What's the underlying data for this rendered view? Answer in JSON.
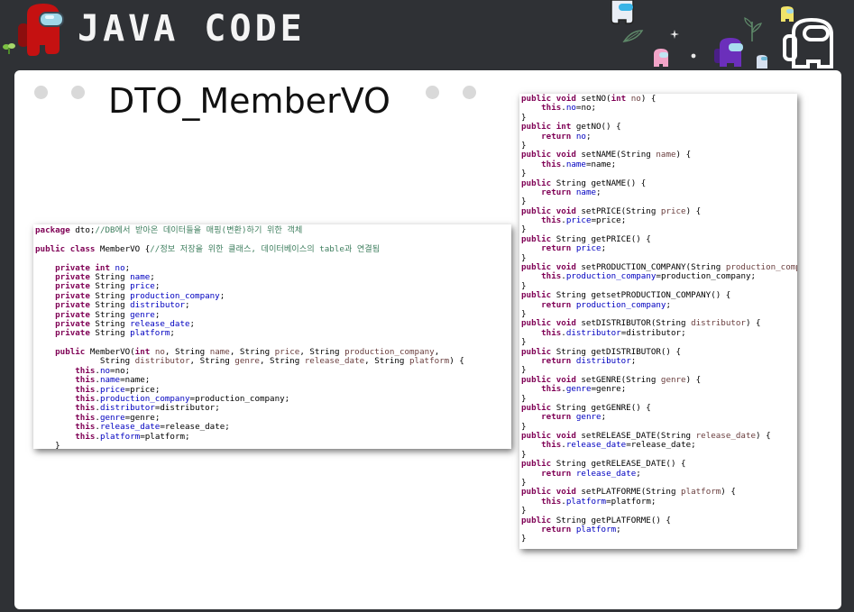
{
  "header": {
    "title": "JAVA CODE"
  },
  "slide": {
    "title": "DTO_MemberVO"
  },
  "left_code": [
    [
      [
        "kw",
        "package"
      ],
      [
        "plain",
        " dto;"
      ],
      [
        "comment",
        "//DB에서 받아온 데이터들을 매핑(변환)하기 위한 객체"
      ]
    ],
    [],
    [
      [
        "kw",
        "public class"
      ],
      [
        "plain",
        " MemberVO {"
      ],
      [
        "comment",
        "//정보 저장을 위한 클래스, 데이터베이스의 table과 연결됨"
      ]
    ],
    [],
    [
      [
        "plain",
        "    "
      ],
      [
        "kw",
        "private int"
      ],
      [
        "plain",
        " "
      ],
      [
        "field",
        "no"
      ],
      [
        "plain",
        ";"
      ]
    ],
    [
      [
        "plain",
        "    "
      ],
      [
        "kw",
        "private"
      ],
      [
        "plain",
        " String "
      ],
      [
        "field",
        "name"
      ],
      [
        "plain",
        ";"
      ]
    ],
    [
      [
        "plain",
        "    "
      ],
      [
        "kw",
        "private"
      ],
      [
        "plain",
        " String "
      ],
      [
        "field",
        "price"
      ],
      [
        "plain",
        ";"
      ]
    ],
    [
      [
        "plain",
        "    "
      ],
      [
        "kw",
        "private"
      ],
      [
        "plain",
        " String "
      ],
      [
        "field",
        "production_company"
      ],
      [
        "plain",
        ";"
      ]
    ],
    [
      [
        "plain",
        "    "
      ],
      [
        "kw",
        "private"
      ],
      [
        "plain",
        " String "
      ],
      [
        "field",
        "distributor"
      ],
      [
        "plain",
        ";"
      ]
    ],
    [
      [
        "plain",
        "    "
      ],
      [
        "kw",
        "private"
      ],
      [
        "plain",
        " String "
      ],
      [
        "field",
        "genre"
      ],
      [
        "plain",
        ";"
      ]
    ],
    [
      [
        "plain",
        "    "
      ],
      [
        "kw",
        "private"
      ],
      [
        "plain",
        " String "
      ],
      [
        "field",
        "release_date"
      ],
      [
        "plain",
        ";"
      ]
    ],
    [
      [
        "plain",
        "    "
      ],
      [
        "kw",
        "private"
      ],
      [
        "plain",
        " String "
      ],
      [
        "field",
        "platform"
      ],
      [
        "plain",
        ";"
      ]
    ],
    [],
    [
      [
        "plain",
        "    "
      ],
      [
        "kw",
        "public"
      ],
      [
        "plain",
        " MemberVO("
      ],
      [
        "kw",
        "int"
      ],
      [
        "plain",
        " "
      ],
      [
        "param",
        "no"
      ],
      [
        "plain",
        ", String "
      ],
      [
        "param",
        "name"
      ],
      [
        "plain",
        ", String "
      ],
      [
        "param",
        "price"
      ],
      [
        "plain",
        ", String "
      ],
      [
        "param",
        "production_company"
      ],
      [
        "plain",
        ","
      ]
    ],
    [
      [
        "plain",
        "             String "
      ],
      [
        "param",
        "distributor"
      ],
      [
        "plain",
        ", String "
      ],
      [
        "param",
        "genre"
      ],
      [
        "plain",
        ", String "
      ],
      [
        "param",
        "release_date"
      ],
      [
        "plain",
        ", String "
      ],
      [
        "param",
        "platform"
      ],
      [
        "plain",
        ") {"
      ]
    ],
    [
      [
        "plain",
        "        "
      ],
      [
        "kw",
        "this"
      ],
      [
        "plain",
        "."
      ],
      [
        "field",
        "no"
      ],
      [
        "plain",
        "=no;"
      ]
    ],
    [
      [
        "plain",
        "        "
      ],
      [
        "kw",
        "this"
      ],
      [
        "plain",
        "."
      ],
      [
        "field",
        "name"
      ],
      [
        "plain",
        "=name;"
      ]
    ],
    [
      [
        "plain",
        "        "
      ],
      [
        "kw",
        "this"
      ],
      [
        "plain",
        "."
      ],
      [
        "field",
        "price"
      ],
      [
        "plain",
        "=price;"
      ]
    ],
    [
      [
        "plain",
        "        "
      ],
      [
        "kw",
        "this"
      ],
      [
        "plain",
        "."
      ],
      [
        "field",
        "production_company"
      ],
      [
        "plain",
        "=production_company;"
      ]
    ],
    [
      [
        "plain",
        "        "
      ],
      [
        "kw",
        "this"
      ],
      [
        "plain",
        "."
      ],
      [
        "field",
        "distributor"
      ],
      [
        "plain",
        "=distributor;"
      ]
    ],
    [
      [
        "plain",
        "        "
      ],
      [
        "kw",
        "this"
      ],
      [
        "plain",
        "."
      ],
      [
        "field",
        "genre"
      ],
      [
        "plain",
        "=genre;"
      ]
    ],
    [
      [
        "plain",
        "        "
      ],
      [
        "kw",
        "this"
      ],
      [
        "plain",
        "."
      ],
      [
        "field",
        "release_date"
      ],
      [
        "plain",
        "=release_date;"
      ]
    ],
    [
      [
        "plain",
        "        "
      ],
      [
        "kw",
        "this"
      ],
      [
        "plain",
        "."
      ],
      [
        "field",
        "platform"
      ],
      [
        "plain",
        "=platform;"
      ]
    ],
    [
      [
        "plain",
        "    }"
      ]
    ]
  ],
  "right_code": [
    [
      [
        "kw",
        "public void"
      ],
      [
        "plain",
        " setNO("
      ],
      [
        "kw",
        "int"
      ],
      [
        "plain",
        " "
      ],
      [
        "param",
        "no"
      ],
      [
        "plain",
        ") {"
      ]
    ],
    [
      [
        "plain",
        "    "
      ],
      [
        "kw",
        "this"
      ],
      [
        "plain",
        "."
      ],
      [
        "field",
        "no"
      ],
      [
        "plain",
        "=no;"
      ]
    ],
    [
      [
        "plain",
        "}"
      ]
    ],
    [
      [
        "kw",
        "public int"
      ],
      [
        "plain",
        " getNO() {"
      ]
    ],
    [
      [
        "plain",
        "    "
      ],
      [
        "kw",
        "return"
      ],
      [
        "plain",
        " "
      ],
      [
        "field",
        "no"
      ],
      [
        "plain",
        ";"
      ]
    ],
    [
      [
        "plain",
        "}"
      ]
    ],
    [
      [
        "kw",
        "public void"
      ],
      [
        "plain",
        " setNAME(String "
      ],
      [
        "param",
        "name"
      ],
      [
        "plain",
        ") {"
      ]
    ],
    [
      [
        "plain",
        "    "
      ],
      [
        "kw",
        "this"
      ],
      [
        "plain",
        "."
      ],
      [
        "field",
        "name"
      ],
      [
        "plain",
        "=name;"
      ]
    ],
    [
      [
        "plain",
        "}"
      ]
    ],
    [
      [
        "kw",
        "public"
      ],
      [
        "plain",
        " String getNAME() {"
      ]
    ],
    [
      [
        "plain",
        "    "
      ],
      [
        "kw",
        "return"
      ],
      [
        "plain",
        " "
      ],
      [
        "field",
        "name"
      ],
      [
        "plain",
        ";"
      ]
    ],
    [
      [
        "plain",
        "}"
      ]
    ],
    [
      [
        "kw",
        "public void"
      ],
      [
        "plain",
        " setPRICE(String "
      ],
      [
        "param",
        "price"
      ],
      [
        "plain",
        ") {"
      ]
    ],
    [
      [
        "plain",
        "    "
      ],
      [
        "kw",
        "this"
      ],
      [
        "plain",
        "."
      ],
      [
        "field",
        "price"
      ],
      [
        "plain",
        "=price;"
      ]
    ],
    [
      [
        "plain",
        "}"
      ]
    ],
    [
      [
        "kw",
        "public"
      ],
      [
        "plain",
        " String getPRICE() {"
      ]
    ],
    [
      [
        "plain",
        "    "
      ],
      [
        "kw",
        "return"
      ],
      [
        "plain",
        " "
      ],
      [
        "field",
        "price"
      ],
      [
        "plain",
        ";"
      ]
    ],
    [
      [
        "plain",
        "}"
      ]
    ],
    [
      [
        "kw",
        "public void"
      ],
      [
        "plain",
        " setPRODUCTION_COMPANY(String "
      ],
      [
        "param",
        "production_company"
      ],
      [
        "plain",
        ") {"
      ]
    ],
    [
      [
        "plain",
        "    "
      ],
      [
        "kw",
        "this"
      ],
      [
        "plain",
        "."
      ],
      [
        "field",
        "production_company"
      ],
      [
        "plain",
        "=production_company;"
      ]
    ],
    [
      [
        "plain",
        "}"
      ]
    ],
    [
      [
        "kw",
        "public"
      ],
      [
        "plain",
        " String getsetPRODUCTION_COMPANY() {"
      ]
    ],
    [
      [
        "plain",
        "    "
      ],
      [
        "kw",
        "return"
      ],
      [
        "plain",
        " "
      ],
      [
        "field",
        "production_company"
      ],
      [
        "plain",
        ";"
      ]
    ],
    [
      [
        "plain",
        "}"
      ]
    ],
    [
      [
        "kw",
        "public void"
      ],
      [
        "plain",
        " setDISTRIBUTOR(String "
      ],
      [
        "param",
        "distributor"
      ],
      [
        "plain",
        ") {"
      ]
    ],
    [
      [
        "plain",
        "    "
      ],
      [
        "kw",
        "this"
      ],
      [
        "plain",
        "."
      ],
      [
        "field",
        "distributor"
      ],
      [
        "plain",
        "=distributor;"
      ]
    ],
    [
      [
        "plain",
        "}"
      ]
    ],
    [
      [
        "kw",
        "public"
      ],
      [
        "plain",
        " String getDISTRIBUTOR() {"
      ]
    ],
    [
      [
        "plain",
        "    "
      ],
      [
        "kw",
        "return"
      ],
      [
        "plain",
        " "
      ],
      [
        "field",
        "distributor"
      ],
      [
        "plain",
        ";"
      ]
    ],
    [
      [
        "plain",
        "}"
      ]
    ],
    [
      [
        "kw",
        "public void"
      ],
      [
        "plain",
        " setGENRE(String "
      ],
      [
        "param",
        "genre"
      ],
      [
        "plain",
        ") {"
      ]
    ],
    [
      [
        "plain",
        "    "
      ],
      [
        "kw",
        "this"
      ],
      [
        "plain",
        "."
      ],
      [
        "field",
        "genre"
      ],
      [
        "plain",
        "=genre;"
      ]
    ],
    [
      [
        "plain",
        "}"
      ]
    ],
    [
      [
        "kw",
        "public"
      ],
      [
        "plain",
        " String getGENRE() {"
      ]
    ],
    [
      [
        "plain",
        "    "
      ],
      [
        "kw",
        "return"
      ],
      [
        "plain",
        " "
      ],
      [
        "field",
        "genre"
      ],
      [
        "plain",
        ";"
      ]
    ],
    [
      [
        "plain",
        "}"
      ]
    ],
    [
      [
        "kw",
        "public void"
      ],
      [
        "plain",
        " setRELEASE_DATE(String "
      ],
      [
        "param",
        "release_date"
      ],
      [
        "plain",
        ") {"
      ]
    ],
    [
      [
        "plain",
        "    "
      ],
      [
        "kw",
        "this"
      ],
      [
        "plain",
        "."
      ],
      [
        "field",
        "release_date"
      ],
      [
        "plain",
        "=release_date;"
      ]
    ],
    [
      [
        "plain",
        "}"
      ]
    ],
    [
      [
        "kw",
        "public"
      ],
      [
        "plain",
        " String getRELEASE_DATE() {"
      ]
    ],
    [
      [
        "plain",
        "    "
      ],
      [
        "kw",
        "return"
      ],
      [
        "plain",
        " "
      ],
      [
        "field",
        "release_date"
      ],
      [
        "plain",
        ";"
      ]
    ],
    [
      [
        "plain",
        "}"
      ]
    ],
    [
      [
        "kw",
        "public void"
      ],
      [
        "plain",
        " setPLATFORME(String "
      ],
      [
        "param",
        "platform"
      ],
      [
        "plain",
        ") {"
      ]
    ],
    [
      [
        "plain",
        "    "
      ],
      [
        "kw",
        "this"
      ],
      [
        "plain",
        "."
      ],
      [
        "field",
        "platform"
      ],
      [
        "plain",
        "=platform;"
      ]
    ],
    [
      [
        "plain",
        "}"
      ]
    ],
    [
      [
        "kw",
        "public"
      ],
      [
        "plain",
        " String getPLATFORME() {"
      ]
    ],
    [
      [
        "plain",
        "    "
      ],
      [
        "kw",
        "return"
      ],
      [
        "plain",
        " "
      ],
      [
        "field",
        "platform"
      ],
      [
        "plain",
        ";"
      ]
    ],
    [
      [
        "plain",
        "}"
      ]
    ]
  ],
  "colors": {
    "background": "#2f3135",
    "slide": "#ffffff",
    "keyword": "#7f0055",
    "field": "#0000c0",
    "comment": "#3f7f5f",
    "crewmate_red": "#c51111",
    "crewmate_purple": "#6b2fbb",
    "crewmate_white": "#d6e0f0"
  },
  "icons": [
    "red-crewmate-icon",
    "sprout-icon",
    "crewmate-icon",
    "white-crewmate-icon",
    "purple-crewmate-icon",
    "pink-crewmate-icon",
    "leaf-icon",
    "star-icon"
  ]
}
